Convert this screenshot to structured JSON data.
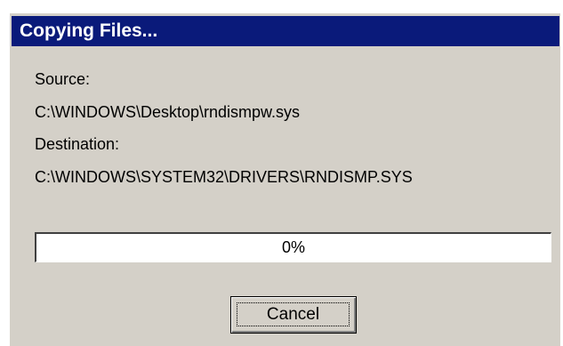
{
  "dialog": {
    "title": "Copying Files...",
    "source_label": "Source:",
    "source_path": "C:\\WINDOWS\\Desktop\\rndismpw.sys",
    "destination_label": "Destination:",
    "destination_path": "C:\\WINDOWS\\SYSTEM32\\DRIVERS\\RNDISMP.SYS",
    "progress": {
      "value_percent": 0,
      "label": "0%"
    },
    "cancel_label": "Cancel"
  },
  "colors": {
    "titlebar": "#0a1a7a",
    "dialog_face": "#d4d0c8"
  }
}
